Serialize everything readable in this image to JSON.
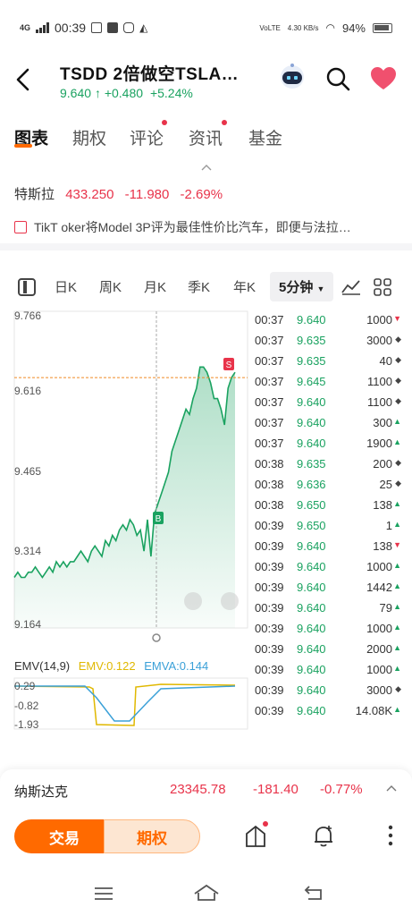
{
  "status": {
    "network": "4G",
    "time": "00:39",
    "lte": "VoLTE",
    "speed": "4.30 KB/s",
    "battery": "94%"
  },
  "header": {
    "title": "TSDD  2倍做空TSLA…",
    "price": "9.640",
    "change": "+0.480",
    "change_pct": "+5.24%"
  },
  "tabs": [
    "图表",
    "期权",
    "评论",
    "资讯",
    "基金"
  ],
  "underlying": {
    "name": "特斯拉",
    "price": "433.250",
    "change": "-11.980",
    "change_pct": "-2.69%"
  },
  "news": "TikT oker将Model 3P评为最佳性价比汽车，即便与法拉…",
  "kline_toolbar": {
    "buttons": [
      "日K",
      "周K",
      "月K",
      "季K",
      "年K"
    ],
    "active": "5分钟"
  },
  "chart_data": {
    "type": "line",
    "yticks": [
      "9.766",
      "9.616",
      "9.465",
      "9.314",
      "9.164"
    ],
    "ylim": [
      9.164,
      9.766
    ],
    "reference_line": 9.64,
    "markers": [
      "B",
      "S"
    ],
    "values": [
      9.26,
      9.27,
      9.26,
      9.26,
      9.27,
      9.27,
      9.28,
      9.27,
      9.26,
      9.27,
      9.28,
      9.27,
      9.29,
      9.28,
      9.29,
      9.28,
      9.29,
      9.29,
      9.3,
      9.31,
      9.3,
      9.29,
      9.31,
      9.32,
      9.31,
      9.3,
      9.33,
      9.32,
      9.34,
      9.33,
      9.35,
      9.36,
      9.35,
      9.37,
      9.36,
      9.34,
      9.35,
      9.31,
      9.37,
      9.3,
      9.38,
      9.4,
      9.42,
      9.44,
      9.46,
      9.5,
      9.52,
      9.54,
      9.56,
      9.58,
      9.57,
      9.6,
      9.62,
      9.66,
      9.66,
      9.65,
      9.63,
      9.6,
      9.6,
      9.58,
      9.55,
      9.62,
      9.64,
      9.65
    ]
  },
  "indicator": {
    "name": "EMV(14,9)",
    "emv": "EMV:0.122",
    "emva": "EMVA:0.144",
    "yticks": [
      "0.29",
      "-0.82",
      "-1.93"
    ]
  },
  "trades": [
    {
      "time": "00:37",
      "price": "9.640",
      "vol": "1000",
      "dir": "down",
      "pc": "up"
    },
    {
      "time": "00:37",
      "price": "9.635",
      "vol": "3000",
      "dir": "flat",
      "pc": "up"
    },
    {
      "time": "00:37",
      "price": "9.635",
      "vol": "40",
      "dir": "flat",
      "pc": "up"
    },
    {
      "time": "00:37",
      "price": "9.645",
      "vol": "1100",
      "dir": "flat",
      "pc": "up"
    },
    {
      "time": "00:37",
      "price": "9.640",
      "vol": "1100",
      "dir": "flat",
      "pc": "up"
    },
    {
      "time": "00:37",
      "price": "9.640",
      "vol": "300",
      "dir": "up",
      "pc": "up"
    },
    {
      "time": "00:37",
      "price": "9.640",
      "vol": "1900",
      "dir": "up",
      "pc": "up"
    },
    {
      "time": "00:38",
      "price": "9.635",
      "vol": "200",
      "dir": "flat",
      "pc": "up"
    },
    {
      "time": "00:38",
      "price": "9.636",
      "vol": "25",
      "dir": "flat",
      "pc": "up"
    },
    {
      "time": "00:38",
      "price": "9.650",
      "vol": "138",
      "dir": "up",
      "pc": "up"
    },
    {
      "time": "00:39",
      "price": "9.650",
      "vol": "1",
      "dir": "up",
      "pc": "up"
    },
    {
      "time": "00:39",
      "price": "9.640",
      "vol": "138",
      "dir": "down",
      "pc": "up"
    },
    {
      "time": "00:39",
      "price": "9.640",
      "vol": "1000",
      "dir": "up",
      "pc": "up"
    },
    {
      "time": "00:39",
      "price": "9.640",
      "vol": "1442",
      "dir": "up",
      "pc": "up"
    },
    {
      "time": "00:39",
      "price": "9.640",
      "vol": "79",
      "dir": "up",
      "pc": "up"
    },
    {
      "time": "00:39",
      "price": "9.640",
      "vol": "1000",
      "dir": "up",
      "pc": "up"
    },
    {
      "time": "00:39",
      "price": "9.640",
      "vol": "2000",
      "dir": "up",
      "pc": "up"
    },
    {
      "time": "00:39",
      "price": "9.640",
      "vol": "1000",
      "dir": "up",
      "pc": "up"
    },
    {
      "time": "00:39",
      "price": "9.640",
      "vol": "3000",
      "dir": "flat",
      "pc": "up"
    },
    {
      "time": "00:39",
      "price": "9.640",
      "vol": "14.08K",
      "dir": "up",
      "pc": "up"
    }
  ],
  "index_bar": {
    "name": "纳斯达克",
    "value": "23345.78",
    "change": "-181.40",
    "change_pct": "-0.77%"
  },
  "actions": {
    "trade": "交易",
    "options": "期权"
  },
  "colors": {
    "up": "#1aa260",
    "down": "#e8334a",
    "accent": "#ff6a00"
  }
}
